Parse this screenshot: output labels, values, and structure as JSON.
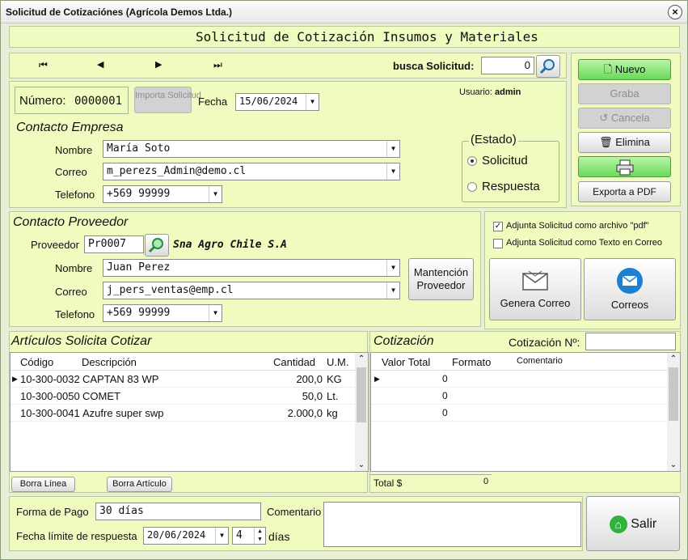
{
  "window": {
    "title": "Solicitud de Cotizaciónes (Agrícola Demos Ltda.)"
  },
  "header": {
    "title": "Solicitud de Cotización Insumos y Materiales"
  },
  "nav": {
    "first": "⏮",
    "prev": "◀",
    "next": "▶",
    "last": "⏭",
    "search_label": "busca Solicitud:",
    "search_value": "0"
  },
  "side_buttons": {
    "nuevo": "Nuevo",
    "graba": "Graba",
    "cancela": "Cancela",
    "elimina": "Elimina",
    "exporta": "Exporta a PDF"
  },
  "doc": {
    "numero_label": "Número:",
    "numero": "0000001",
    "importa": "Importa Solicitud",
    "fecha_label": "Fecha",
    "fecha": "15/06/2024",
    "usuario_label": "Usuario:",
    "usuario": "admin"
  },
  "empresa": {
    "title": "Contacto Empresa",
    "nombre_label": "Nombre",
    "nombre": "María Soto",
    "correo_label": "Correo",
    "correo": "m_perezs_Admin@demo.cl",
    "telefono_label": "Telefono",
    "telefono": "+569 99999"
  },
  "estado": {
    "title": "(Estado)",
    "solicitud": "Solicitud",
    "respuesta": "Respuesta"
  },
  "proveedor": {
    "title": "Contacto Proveedor",
    "prov_label": "Proveedor",
    "codigo": "Pr0007",
    "nombre_empresa": "Sna Agro Chile S.A",
    "nombre_label": "Nombre",
    "nombre": "Juan Perez",
    "correo_label": "Correo",
    "correo": "j_pers_ventas@emp.cl",
    "telefono_label": "Telefono",
    "telefono": "+569 99999",
    "mantencion": "Mantención Proveedor"
  },
  "envio": {
    "adjunta_pdf": "Adjunta Solicitud como archivo \"pdf\"",
    "adjunta_texto": "Adjunta Solicitud como Texto en Correo",
    "genera": "Genera Correo",
    "correos": "Correos"
  },
  "articulos": {
    "title": "Artículos Solicita Cotizar",
    "columns": [
      "Código",
      "Descripción",
      "Cantidad",
      "U.M."
    ],
    "rows": [
      [
        "10-300-0032",
        "CAPTAN 83 WP",
        "200,0",
        "KG"
      ],
      [
        "10-300-0050",
        "COMET",
        "50,0",
        "Lt."
      ],
      [
        "10-300-0041",
        "Azufre super swp",
        "2.000,0",
        "kg"
      ]
    ],
    "borra_linea": "Borra Línea",
    "borra_articulo": "Borra Artículo"
  },
  "cotizacion": {
    "title": "Cotización",
    "numero_label": "Cotización Nº:",
    "numero": "",
    "columns": [
      "Valor Total",
      "Formato",
      "Comentario"
    ],
    "rows": [
      [
        "0",
        "",
        ""
      ],
      [
        "0",
        "",
        ""
      ],
      [
        "0",
        "",
        ""
      ]
    ],
    "total_label": "Total $",
    "total": "0"
  },
  "footer": {
    "forma_pago_label": "Forma de Pago",
    "forma_pago": "30 días",
    "comentario_label": "Comentario",
    "comentario": "",
    "fecha_limite_label": "Fecha límite de respuesta",
    "fecha_limite": "20/06/2024",
    "dias": "4",
    "dias_label": "días",
    "salir": "Salir"
  },
  "colors": {
    "panel": "#f0fbc0",
    "window": "#e8efd6",
    "green_button": "#6bd95a"
  }
}
